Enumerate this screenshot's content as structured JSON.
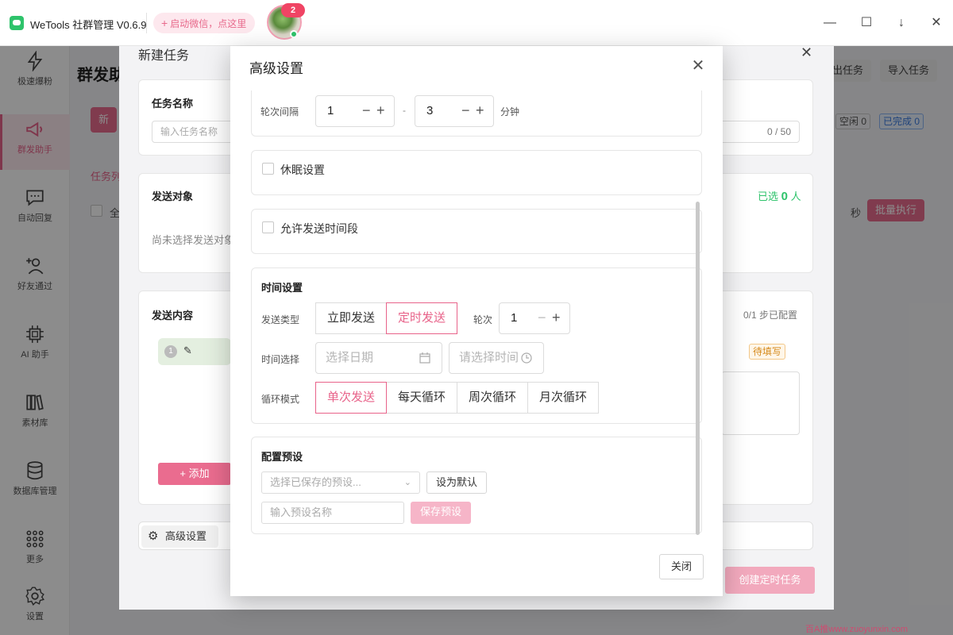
{
  "titlebar": {
    "app_title": "WeTools 社群管理 V0.6.9",
    "wx_button": "启动微信，点这里",
    "badge_count": "2",
    "controls": [
      "minimize",
      "maximize",
      "download",
      "close"
    ]
  },
  "sidebar": {
    "items": [
      {
        "label": "极速爆粉",
        "icon": "lightning-icon"
      },
      {
        "label": "群发助手",
        "icon": "megaphone-icon",
        "active": true
      },
      {
        "label": "自动回复",
        "icon": "chat-icon"
      },
      {
        "label": "好友通过",
        "icon": "add-user-icon"
      },
      {
        "label": "AI 助手",
        "icon": "chip-icon"
      },
      {
        "label": "素材库",
        "icon": "library-icon"
      },
      {
        "label": "数据库管理",
        "icon": "database-icon"
      },
      {
        "label": "更多",
        "icon": "grid-icon"
      },
      {
        "label": "设置",
        "icon": "gear-icon"
      }
    ]
  },
  "background": {
    "page_title": "群发助",
    "export_button": "出任务",
    "import_button": "导入任务",
    "new_button": "新",
    "tag_idle": "空闲 0",
    "tag_done": "已完成 0",
    "tab_label": "任务列",
    "select_all": "全",
    "seconds": "秒",
    "batch_button": "批量执行"
  },
  "task_dialog": {
    "title": "新建任务",
    "task_name": {
      "title": "任务名称",
      "placeholder": "输入任务名称",
      "counter": "0 / 50"
    },
    "target": {
      "title": "发送对象",
      "selected_prefix": "已选",
      "selected_count": "0",
      "selected_suffix": "人",
      "empty_text": "尚未选择发送对象"
    },
    "content": {
      "title": "发送内容",
      "steps": "0/1 步已配置",
      "step_num": "1",
      "pending_tag": "待填写",
      "add_button": "+ 添加"
    },
    "advanced_button": "高级设置",
    "create_button": "创建定时任务"
  },
  "modal": {
    "title": "高级设置",
    "round_interval": {
      "label": "轮次间隔",
      "min": "1",
      "dash": "-",
      "max": "3",
      "unit": "分钟"
    },
    "sleep": {
      "label": "休眠设置"
    },
    "allow_window": {
      "label": "允许发送时间段"
    },
    "time_settings": {
      "title": "时间设置",
      "send_type_label": "发送类型",
      "send_types": [
        "立即发送",
        "定时发送"
      ],
      "send_type_selected": "定时发送",
      "rounds_label": "轮次",
      "rounds": "1",
      "time_select_label": "时间选择",
      "date_placeholder": "选择日期",
      "time_placeholder": "请选择时间",
      "loop_label": "循环模式",
      "loop_modes": [
        "单次发送",
        "每天循环",
        "周次循环",
        "月次循环"
      ],
      "loop_selected": "单次发送"
    },
    "preset": {
      "title": "配置预设",
      "select_placeholder": "选择已保存的预设...",
      "set_default": "设为默认",
      "name_placeholder": "输入预设名称",
      "save_button": "保存预设"
    },
    "close_button": "关闭"
  },
  "watermark": "百A推www.zuoyunxin.com",
  "colors": {
    "accent": "#e8638a",
    "green": "#2ec36b",
    "badge": "#f04464"
  }
}
